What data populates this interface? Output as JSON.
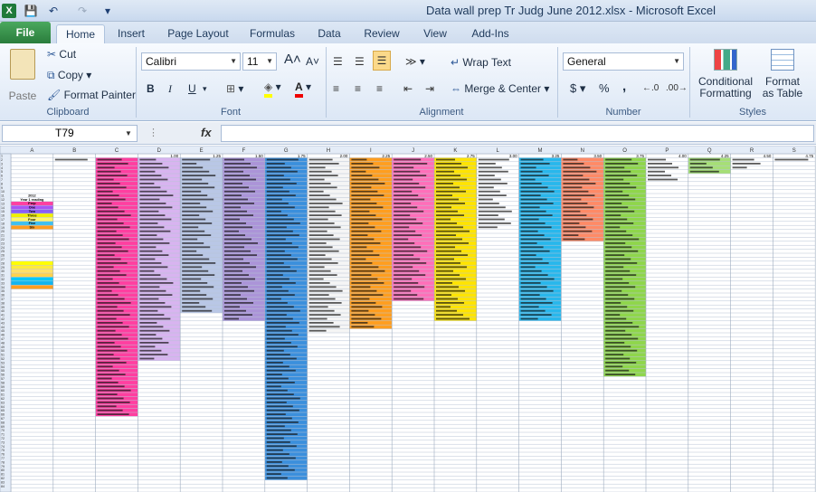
{
  "window": {
    "title": "Data wall prep Tr Judg June 2012.xlsx  -  Microsoft Excel"
  },
  "quick_access": {
    "app_icon": "X",
    "save": "💾",
    "undo": "↶",
    "redo": "↷",
    "more": "▾"
  },
  "tabs": [
    "File",
    "Home",
    "Insert",
    "Page Layout",
    "Formulas",
    "Data",
    "Review",
    "View",
    "Add-Ins"
  ],
  "ribbon": {
    "clipboard": {
      "paste": "Paste",
      "cut": "Cut",
      "copy": "Copy",
      "format_painter": "Format Painter",
      "label": "Clipboard"
    },
    "font": {
      "name": "Calibri",
      "size": "11",
      "grow": "A",
      "shrink": "A",
      "bold": "B",
      "italic": "I",
      "underline": "U",
      "label": "Font"
    },
    "alignment": {
      "wrap": "Wrap Text",
      "merge": "Merge & Center",
      "label": "Alignment"
    },
    "number": {
      "format": "General",
      "currency": "$",
      "percent": "%",
      "comma": ",",
      "label": "Number"
    },
    "styles": {
      "conditional": "Conditional",
      "conditional2": "Formatting",
      "format_as": "Format",
      "format_as2": "as Table",
      "label": "Styles"
    }
  },
  "formula_bar": {
    "name_box": "T79",
    "fx": "fx"
  },
  "sheet": {
    "columns": [
      "A",
      "B",
      "C",
      "D",
      "E",
      "F",
      "G",
      "H",
      "I",
      "J",
      "K",
      "L",
      "M",
      "N",
      "O",
      "P",
      "Q",
      "R",
      "S"
    ],
    "row1_values": [
      "",
      "",
      "",
      "1.00",
      "1.25",
      "1.50",
      "1.75",
      "2.00",
      "2.25",
      "2.50",
      "2.75",
      "3.00",
      "3.25",
      "3.50",
      "3.75",
      "4.00",
      "4.25",
      "4.50",
      "4.75"
    ],
    "legend": [
      "2012",
      "Year 1 reading",
      "Prep",
      "One",
      "Two",
      "Three",
      "Four",
      "Five",
      "Six"
    ],
    "colors": {
      "B": "#ffffff",
      "C": "#ff3fa0",
      "D": "#d8b4f0",
      "E": "#b9c7e6",
      "F": "#ab94d8",
      "G": "#3b8fdc",
      "H": "#f5f5f5",
      "I": "#ff9e1f",
      "J": "#ff6fb9",
      "K": "#ffe400",
      "L": "#ffffff",
      "M": "#28b7ec",
      "N": "#ff8a66",
      "O": "#8fd64b",
      "P": "#ffffff",
      "Q": "#a6df76",
      "R": "#ffffff",
      "S": "#ffffff",
      "legend": [
        "#ffffff",
        "#ffffff",
        "#ff3fa0",
        "#a855f7",
        "#8b5cf6",
        "#f0f000",
        "#fff66a",
        "#3ec0f0",
        "#ff9e1f"
      ]
    },
    "fill_rows": {
      "B": 2,
      "C": 66,
      "D": 52,
      "E": 40,
      "F": 42,
      "G": 82,
      "H": 45,
      "I": 44,
      "J": 37,
      "K": 42,
      "L": 19,
      "M": 42,
      "N": 22,
      "O": 56,
      "P": 7,
      "Q": 5,
      "R": 4,
      "S": 2
    },
    "a_block": {
      "from": 28,
      "to": 34,
      "colors": [
        "#ffff00",
        "#ffeb3b",
        "#ffe066",
        "#ffd24d",
        "#00c8f8",
        "#12b5ef",
        "#ff9e1f"
      ]
    }
  }
}
